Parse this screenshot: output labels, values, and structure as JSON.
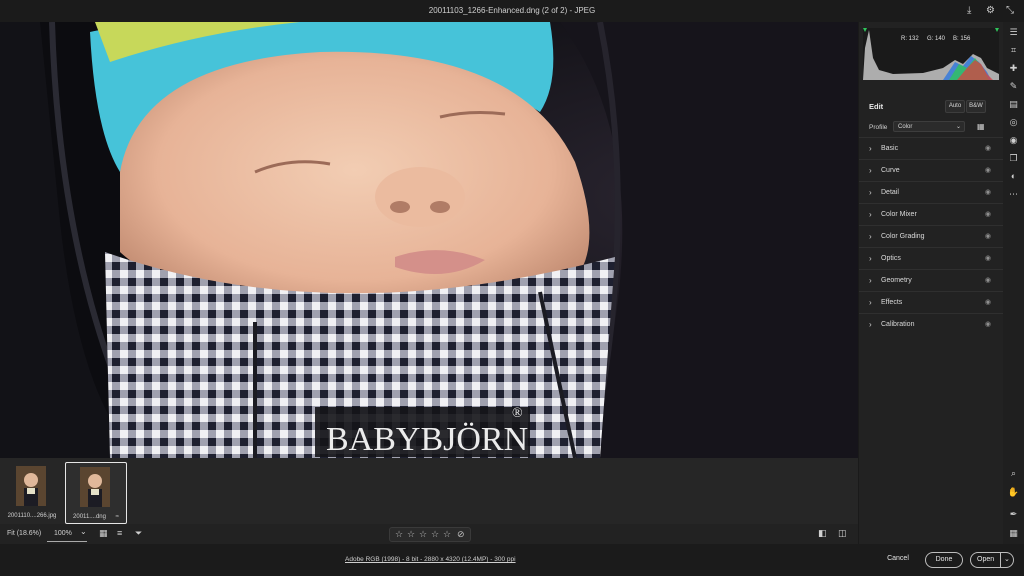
{
  "window": {
    "title": "20011103_1266-Enhanced.dng (2 of 2)  -  JPEG"
  },
  "titlebar_icons": [
    "download-icon",
    "gear-icon",
    "collapse-icon"
  ],
  "canvas": {
    "brand_text": "BABYBJÖRN",
    "registered_mark": "®"
  },
  "filmstrip": {
    "items": [
      {
        "label": "2001110....266.jpg",
        "selected": false
      },
      {
        "label": "20011....dng",
        "selected": true,
        "badge": "≈"
      }
    ]
  },
  "zoom": {
    "fit_label": "Fit (18.6%)",
    "zoom_value": "100%",
    "caret": "⌄"
  },
  "rating": {
    "stars": [
      "☆",
      "☆",
      "☆",
      "☆",
      "☆"
    ],
    "reject": "⊘"
  },
  "status": {
    "metadata": "Adobe RGB (1998) - 8 bit - 2880 x 4320 (12.4MP) - 300 ppi",
    "cancel": "Cancel",
    "done": "Done",
    "open": "Open",
    "open_caret": "⌄"
  },
  "histogram": {
    "r": "R: 132",
    "g": "G: 140",
    "b": "B: 156"
  },
  "edit": {
    "header": "Edit",
    "auto": "Auto",
    "bw": "B&W",
    "profile_label": "Profile",
    "profile_value": "Color",
    "sections": [
      "Basic",
      "Curve",
      "Detail",
      "Color Mixer",
      "Color Grading",
      "Optics",
      "Geometry",
      "Effects",
      "Calibration"
    ]
  },
  "colors": {
    "panel_bg": "#222222",
    "titlebar_bg": "#1b1b1b",
    "text": "#d6d6d6"
  }
}
